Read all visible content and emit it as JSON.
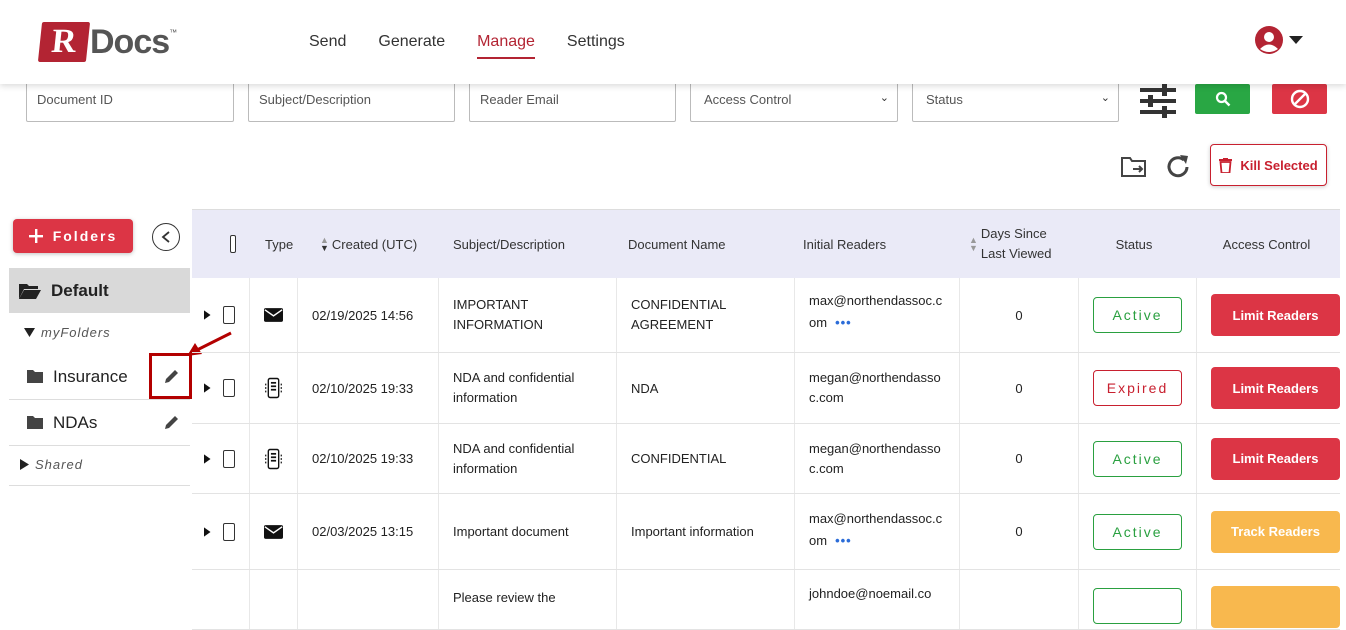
{
  "header": {
    "logo_r": "R",
    "logo_text": "Docs",
    "logo_tm": "™",
    "nav": [
      {
        "label": "Send",
        "active": false
      },
      {
        "label": "Generate",
        "active": false
      },
      {
        "label": "Manage",
        "active": true
      },
      {
        "label": "Settings",
        "active": false
      }
    ]
  },
  "filters": {
    "document_id": "Document ID",
    "subject": "Subject/Description",
    "reader_email": "Reader Email",
    "access_control": "Access Control",
    "status": "Status"
  },
  "toolbar": {
    "kill_selected": "Kill Selected"
  },
  "sidebar": {
    "folders_button": "Folders",
    "default_folder": "Default",
    "my_folders_label": "myFolders",
    "folders": [
      {
        "name": "Insurance"
      },
      {
        "name": "NDAs"
      }
    ],
    "shared_label": "Shared"
  },
  "table": {
    "headers": {
      "type": "Type",
      "created": "Created (UTC)",
      "subject": "Subject/Description",
      "document_name": "Document Name",
      "initial_readers": "Initial Readers",
      "days_since_1": "Days Since",
      "days_since_2": "Last Viewed",
      "status": "Status",
      "access_control": "Access Control"
    },
    "rows": [
      {
        "type_icon": "envelope-icon",
        "created": "02/19/2025 14:56",
        "subject": "IMPORTANT INFORMATION",
        "document": "CONFIDENTIAL AGREEMENT",
        "readers": "max@northendassoc.com",
        "more": true,
        "days": "0",
        "status": "Active",
        "access": "Limit Readers"
      },
      {
        "type_icon": "document-icon",
        "created": "02/10/2025 19:33",
        "subject": "NDA and confidential information",
        "document": "NDA",
        "readers": "megan@northendassoc.com",
        "more": false,
        "days": "0",
        "status": "Expired",
        "access": "Limit Readers"
      },
      {
        "type_icon": "document-icon",
        "created": "02/10/2025 19:33",
        "subject": "NDA and confidential information",
        "document": "CONFIDENTIAL",
        "readers": "megan@northendassoc.com",
        "more": false,
        "days": "0",
        "status": "Active",
        "access": "Limit Readers"
      },
      {
        "type_icon": "envelope-icon",
        "created": "02/03/2025 13:15",
        "subject": "Important document",
        "document": "Important information",
        "readers": "max@northendassoc.com",
        "more": true,
        "days": "0",
        "status": "Active",
        "access": "Track Readers"
      },
      {
        "type_icon": "",
        "created": "",
        "subject": "Please review the",
        "document": "",
        "readers": "johndoe@noemail.co",
        "more": false,
        "days": "",
        "status": "",
        "access": ""
      }
    ]
  },
  "colors": {
    "brand_red": "#dc3545",
    "active_green": "#2aa040",
    "track_orange": "#f8b84e",
    "search_green": "#29a744"
  }
}
